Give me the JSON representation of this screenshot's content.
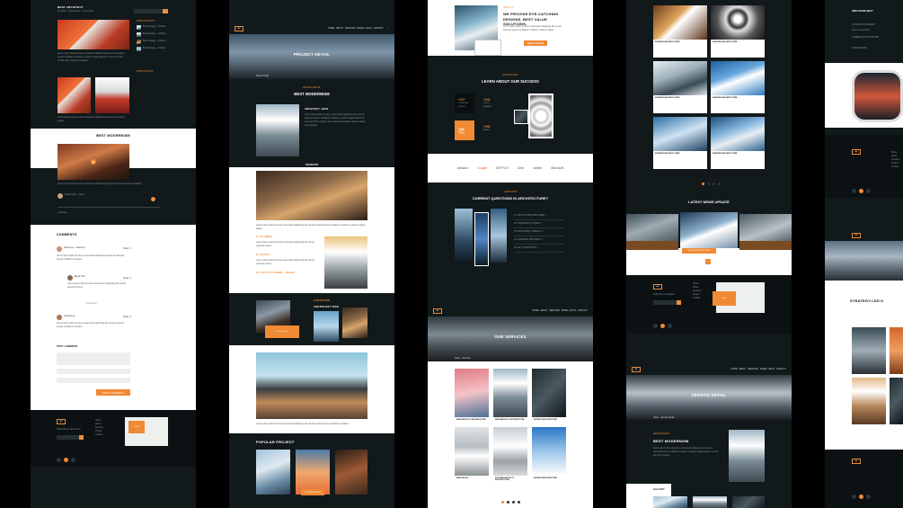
{
  "col1": {
    "post_title": "BEST ARCHITECT",
    "popular_posts_title": "POPULAR POSTS",
    "tags_title": "POPULAR TAGS",
    "highlight_title": "BEST MODERNISM",
    "comments_title": "COMMENTS",
    "post_comment_title": "POST COMMENT",
    "post_button": "POST COMMENT",
    "read_more": "Read More"
  },
  "col2": {
    "page_title": "PROJECT DETAIL",
    "breadcrumb": "Project Detail",
    "section_sub": "PROJECT DETAIL",
    "section_title": "BEST MODERNISM",
    "architect_label": "ARCHITECT: JOHN",
    "bedroom": "BEDROOM",
    "team_title": "OUR DESIGNS",
    "popular_title": "POPULAR PROJECT",
    "accent_labels": [
      "01. PLANNING",
      "02. DESIGN",
      "03. STEP OF PLANNING - DESIGN"
    ],
    "card_label": "MODERN DESIGN"
  },
  "col3": {
    "hero_sub": "ABOUT US",
    "hero_title": "WE PROVIDE EYE-CATCHING DESIGNS, BEST VALUE SOLUTIONS.",
    "hero_button": "READ MORE",
    "success_sub": "OUR SUCCESS",
    "success_title": "LEARN ABOUT OUR SUCCESS",
    "stats": [
      {
        "value": "+47",
        "label": "COMPLETED PROJECT"
      },
      {
        "value": "+24",
        "label": "EXPERT MEMBERS"
      },
      {
        "value": "+56",
        "label": "HAPPY CLIENTS"
      },
      {
        "value": "+90",
        "label": "AWARDS"
      }
    ],
    "brands": [
      "amazon",
      "Google",
      "NETFLIX",
      "Uber",
      "webex",
      "Microsoft"
    ],
    "faq_sub": "QUESTIONS",
    "faq_title": "CURRENT QUESTIONS IN ARCHITECTURE?",
    "services_title": "OUR SERVICES",
    "services": [
      "RENOVATION OF ARCHITECTURE",
      "RENOVATION OF ARCHITECTURE",
      "INTERIOR ARCHITECTURE",
      "RENOVATION",
      "FOR RENOVATION OF ARCHITECTURE",
      "INTERIOR ARCHITECTURE"
    ]
  },
  "col4": {
    "cards": [
      "MODERN ARCHITECTURE",
      "MODERN ARCHITECTURE",
      "MODERN ARCHITECTURE",
      "MODERN ARCHITECTURE",
      "MODERN ARCHITECTURE",
      "MODERN ARCHITECTURE"
    ],
    "news_title": "LATEST NEWS UPDATE",
    "news_badge": "MODERN ARCHITECTURE",
    "service_title": "SERVICE DETAIL",
    "service_sub": "SERVICE DETAIL",
    "service_heading": "BEST MODERNISM",
    "gallery": "GALLERY"
  },
  "col5": {
    "faq_label": "HOW CAN WE HELP?",
    "strategy_title": "STRATEGY-LED D"
  },
  "colors": {
    "accent": "#f08a34",
    "dark": "#11191b"
  }
}
